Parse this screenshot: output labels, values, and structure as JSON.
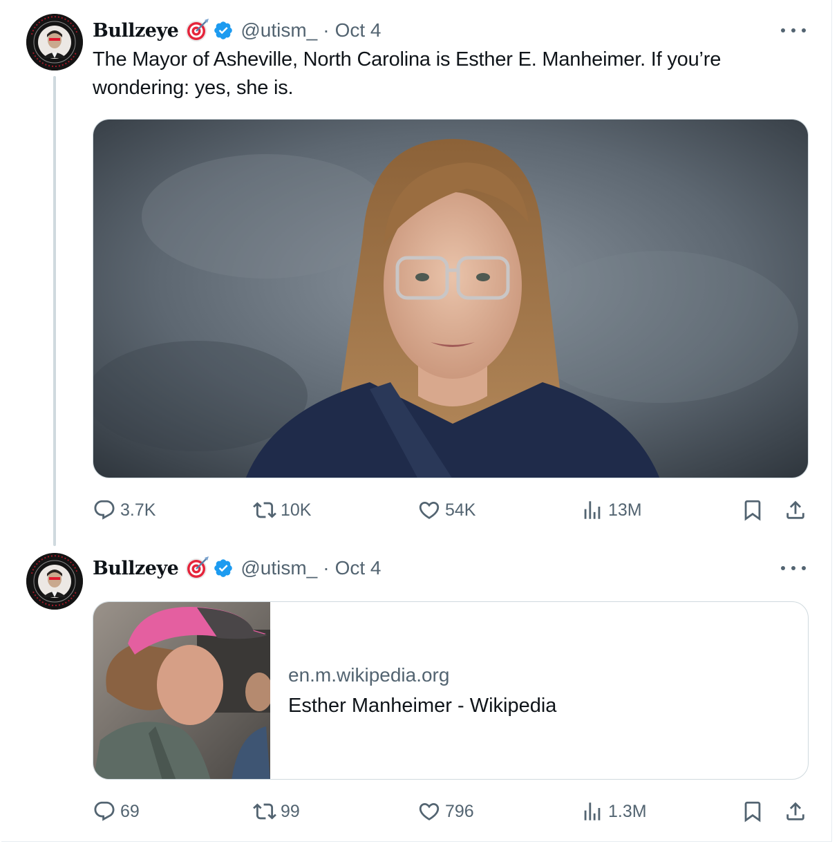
{
  "tweets": [
    {
      "author": {
        "display_name": "Bullzeye",
        "name_emoji": "direct-hit-emoji",
        "verified": true,
        "handle": "@utism_",
        "separator": "·",
        "date": "Oct 4"
      },
      "text": "The Mayor of Asheville, North Carolina is Esther E. Manheimer. If you’re wondering: yes, she is.",
      "media": {
        "kind": "photo"
      },
      "stats": {
        "replies": "3.7K",
        "reposts": "10K",
        "likes": "54K",
        "views": "13M"
      }
    },
    {
      "author": {
        "display_name": "Bullzeye",
        "name_emoji": "direct-hit-emoji",
        "verified": true,
        "handle": "@utism_",
        "separator": "·",
        "date": "Oct 4"
      },
      "link_card": {
        "domain": "en.m.wikipedia.org",
        "title": "Esther Manheimer - Wikipedia"
      },
      "stats": {
        "replies": "69",
        "reposts": "99",
        "likes": "796",
        "views": "1.3M"
      }
    }
  ],
  "colors": {
    "text_primary": "#0f1419",
    "text_secondary": "#536471",
    "verified_blue": "#1d9bf0",
    "border": "#cfd9de",
    "thread_line": "#cfd9de"
  },
  "icons": [
    "reply-icon",
    "repost-icon",
    "like-icon",
    "views-icon",
    "bookmark-icon",
    "share-icon",
    "more-icon",
    "verified-badge-icon",
    "direct-hit-emoji"
  ]
}
